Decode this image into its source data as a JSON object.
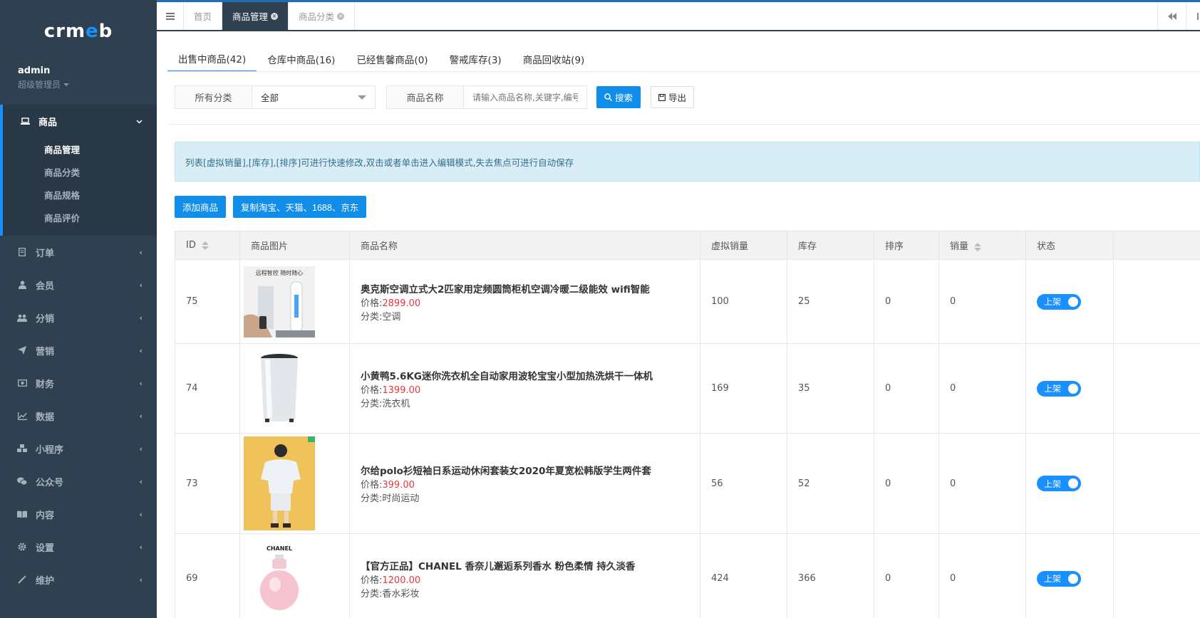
{
  "logo": {
    "text_a": "crm",
    "text_b": "e",
    "text_c": "b"
  },
  "profile": {
    "username": "admin",
    "role": "超级管理员"
  },
  "sidebar": {
    "active_section": {
      "label": "商品",
      "subitems": [
        "商品管理",
        "商品分类",
        "商品规格",
        "商品评价"
      ],
      "active_index": 0
    },
    "items": [
      {
        "label": "订单",
        "icon": "order-icon"
      },
      {
        "label": "会员",
        "icon": "user-icon"
      },
      {
        "label": "分销",
        "icon": "users-icon"
      },
      {
        "label": "营销",
        "icon": "send-icon"
      },
      {
        "label": "财务",
        "icon": "money-icon"
      },
      {
        "label": "数据",
        "icon": "chart-icon"
      },
      {
        "label": "小程序",
        "icon": "cubes-icon"
      },
      {
        "label": "公众号",
        "icon": "wechat-icon"
      },
      {
        "label": "内容",
        "icon": "book-icon"
      },
      {
        "label": "设置",
        "icon": "gear-icon"
      },
      {
        "label": "维护",
        "icon": "magic-icon"
      }
    ]
  },
  "topbar": {
    "tabs": [
      {
        "label": "首页"
      },
      {
        "label": "商品管理",
        "active": true
      },
      {
        "label": "商品分类"
      }
    ]
  },
  "pagetabs": [
    "出售中商品(42)",
    "仓库中商品(16)",
    "已经售馨商品(0)",
    "警戒库存(3)",
    "商品回收站(9)"
  ],
  "filters": {
    "category_label": "所有分类",
    "category_value": "全部",
    "name_label": "商品名称",
    "name_placeholder": "请输入商品名称,关键字,编号",
    "search_button": "搜索",
    "export_button": "导出"
  },
  "notice": "列表[虚拟销量],[库存],[排序]可进行快速修改,双击或者单击进入编辑模式,失去焦点可进行自动保存",
  "actions": {
    "add": "添加商品",
    "copy": "复制淘宝、天猫、1688、京东"
  },
  "table": {
    "headers": [
      "ID",
      "商品图片",
      "商品名称",
      "虚拟销量",
      "库存",
      "排序",
      "销量",
      "状态"
    ],
    "price_prefix": "价格:",
    "category_prefix": "分类:",
    "rows": [
      {
        "id": "75",
        "name": "奥克斯空调立式大2匹家用定频圆筒柜机空调冷暖二级能效 wifi智能",
        "price": "2899.00",
        "category": "空调",
        "virtual_sales": "100",
        "stock": "25",
        "sort": "0",
        "sales": "0",
        "status": "上架",
        "image_caption": "远程智控 随时随心"
      },
      {
        "id": "74",
        "name": "小黄鸭5.6KG迷你洗衣机全自动家用波轮宝宝小型加热洗烘干一体机",
        "price": "1399.00",
        "category": "洗衣机",
        "virtual_sales": "169",
        "stock": "35",
        "sort": "0",
        "sales": "0",
        "status": "上架"
      },
      {
        "id": "73",
        "name": "尔给polo衫短袖日系运动休闲套装女2020年夏宽松韩版学生两件套",
        "price": "399.00",
        "category": "时尚运动",
        "virtual_sales": "56",
        "stock": "52",
        "sort": "0",
        "sales": "0",
        "status": "上架"
      },
      {
        "id": "69",
        "name": "【官方正品】CHANEL 香奈儿邂逅系列香水 粉色柔情 持久淡香",
        "price": "1200.00",
        "category": "香水彩妆",
        "virtual_sales": "424",
        "stock": "366",
        "sort": "0",
        "sales": "0",
        "status": "上架",
        "image_caption": "CHANEL"
      }
    ]
  },
  "colors": {
    "sidebar": "#2f4050",
    "accent": "#1890ff",
    "price": "#e4393c",
    "notice_bg": "#d9edf7"
  }
}
